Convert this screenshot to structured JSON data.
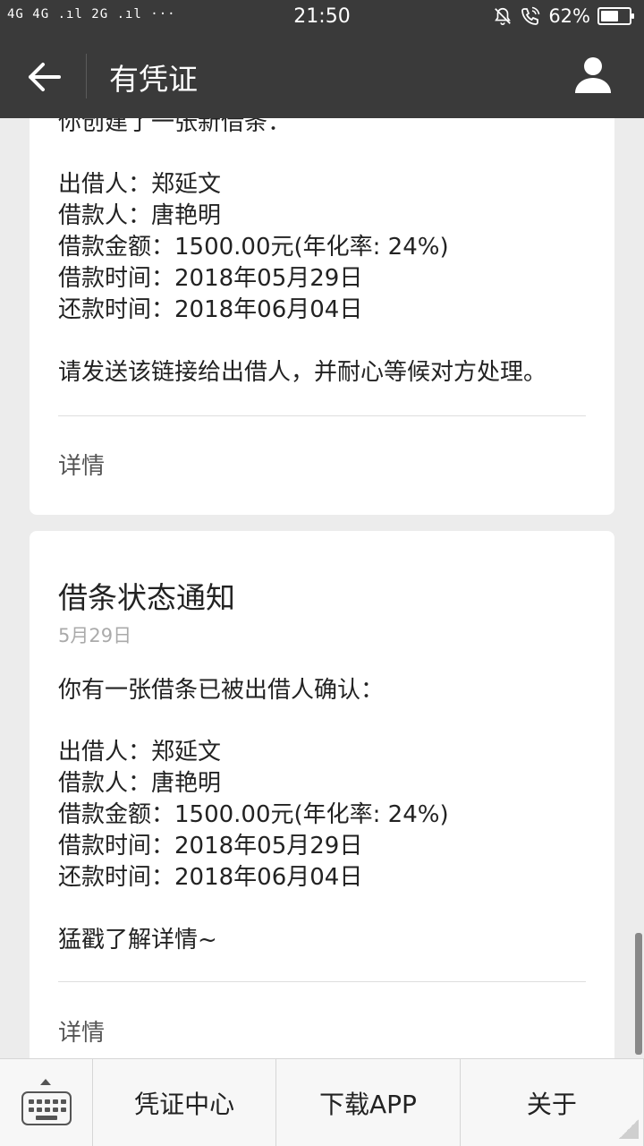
{
  "status_bar": {
    "network": "4G 4G .ıl 2G .ıl ···",
    "time": "21:50",
    "battery": "62%",
    "battery_level": 0.62
  },
  "app_bar": {
    "title": "有凭证"
  },
  "card1": {
    "intro": "你创建了一张新借条：",
    "lender": "出借人：郑延文",
    "borrower": "借款人：唐艳明",
    "amount": "借款金额：1500.00元(年化率: 24%)",
    "loan_date": "借款时间：2018年05月29日",
    "repay_date": "还款时间：2018年06月04日",
    "note": "请发送该链接给出借人，并耐心等候对方处理。",
    "detail": "详情"
  },
  "card2": {
    "heading": "借条状态通知",
    "date": "5月29日",
    "intro": "你有一张借条已被出借人确认：",
    "lender": "出借人：郑延文",
    "borrower": "借款人：唐艳明",
    "amount": "借款金额：1500.00元(年化率: 24%)",
    "loan_date": "借款时间：2018年05月29日",
    "repay_date": "还款时间：2018年06月04日",
    "link": "猛戳了解详情~",
    "detail": "详情"
  },
  "bottom_nav": {
    "items": [
      {
        "label": "凭证中心"
      },
      {
        "label": "下载APP"
      },
      {
        "label": "关于"
      }
    ]
  },
  "icons": {
    "back": "back-arrow-icon",
    "user": "user-icon",
    "keyboard": "keyboard-icon",
    "mute": "bell-off-icon",
    "wifi_call": "wifi-call-icon"
  },
  "colors": {
    "bar": "#3a3a3a",
    "accent_blue": "#3b8fd8",
    "background": "#ececec"
  }
}
